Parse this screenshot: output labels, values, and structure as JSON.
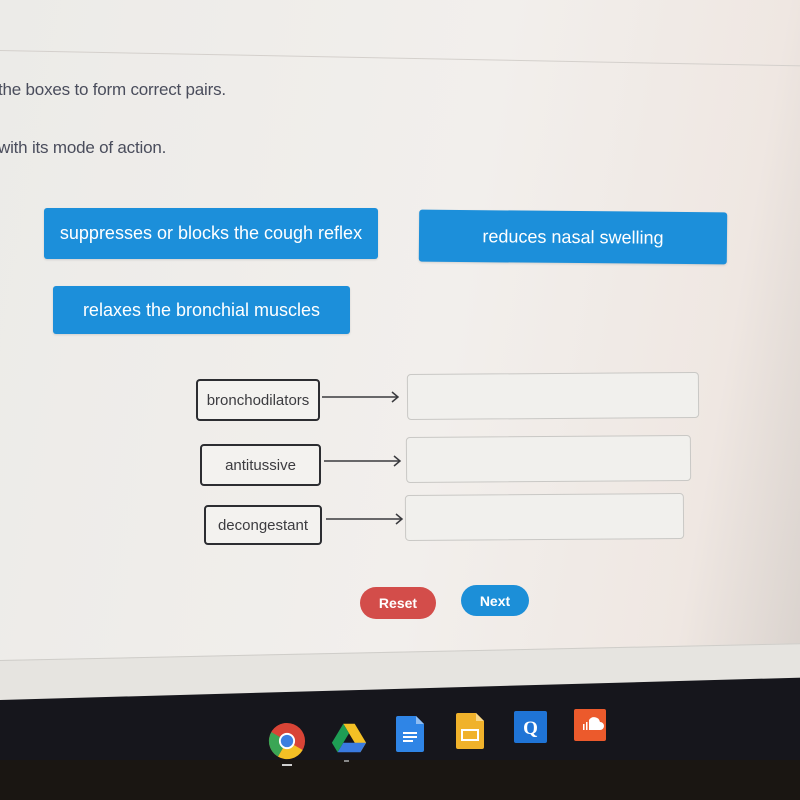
{
  "instructions": {
    "line1": "the boxes to form correct pairs.",
    "line2": "with its mode of action."
  },
  "options": [
    {
      "label": "suppresses or blocks the cough reflex"
    },
    {
      "label": "reduces nasal swelling"
    },
    {
      "label": "relaxes the bronchial muscles"
    }
  ],
  "pairs": [
    {
      "term": "bronchodilators",
      "target_value": ""
    },
    {
      "term": "antitussive",
      "target_value": ""
    },
    {
      "term": "decongestant",
      "target_value": ""
    }
  ],
  "buttons": {
    "reset": "Reset",
    "next": "Next"
  },
  "colors": {
    "option_chip": "#1c8fda",
    "reset_button": "#d34d4a",
    "next_button": "#1c8fd8"
  },
  "shelf": {
    "apps": [
      "chrome-icon",
      "google-drive-icon",
      "google-docs-icon",
      "google-slides-icon",
      "quizlet-icon",
      "soundcloud-icon"
    ]
  }
}
